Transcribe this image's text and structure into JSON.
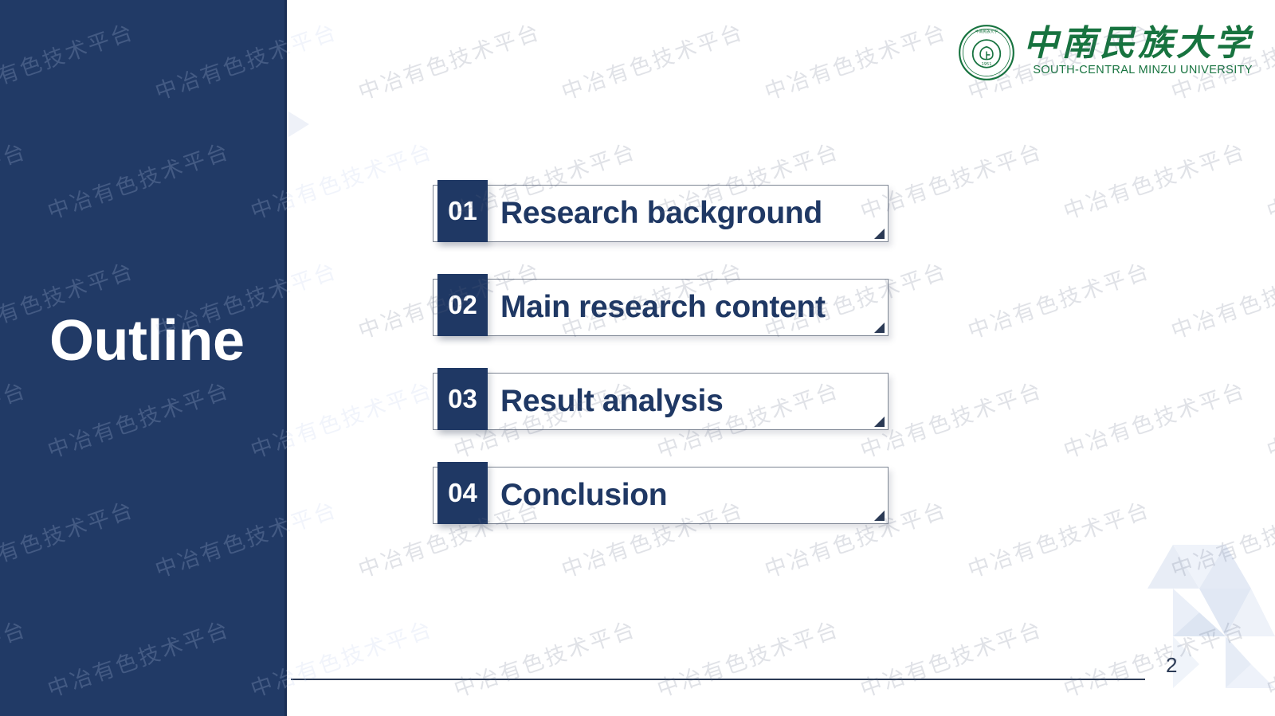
{
  "slide": {
    "title": "Outline",
    "page_number": "2",
    "accent_navy": "#1f3864",
    "panel_navy": "#213a66",
    "logo_green": "#17733f",
    "border_gray": "#7e8694"
  },
  "logo": {
    "name_cn": "中南民族大学",
    "name_en": "SOUTH-CENTRAL MINZU UNIVERSITY",
    "seal_year": "1951",
    "seal_ring_text": "SOUTH-CENTRAL MINZU UNIVERSITY"
  },
  "outline": {
    "items": [
      {
        "number": "01",
        "label": "Research background"
      },
      {
        "number": "02",
        "label": "Main research content"
      },
      {
        "number": "03",
        "label": "Result analysis"
      },
      {
        "number": "04",
        "label": "Conclusion"
      }
    ]
  },
  "watermark": {
    "text": "中冶有色技术平台"
  }
}
